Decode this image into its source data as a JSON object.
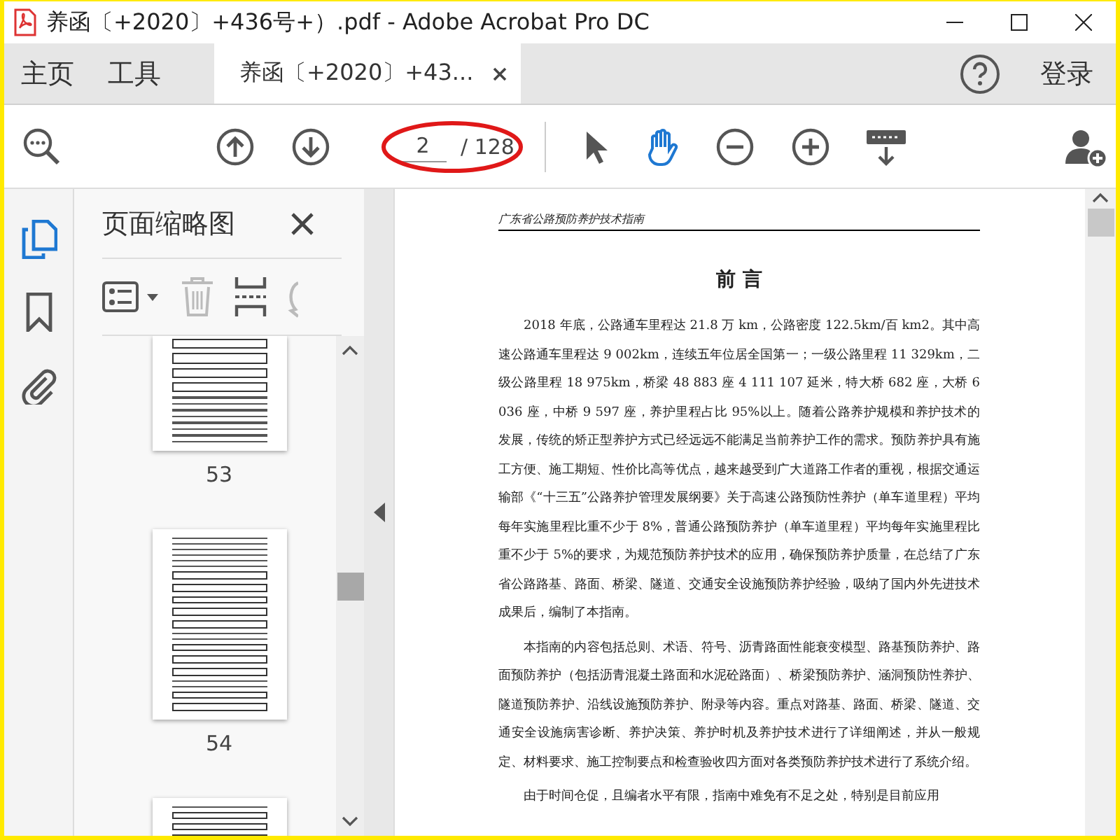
{
  "window": {
    "title": "养函〔+2020〕+436号+）.pdf - Adobe Acrobat Pro DC"
  },
  "tabs": [
    {
      "label": "主页",
      "kind": "nav",
      "selected": false
    },
    {
      "label": "工具",
      "kind": "nav",
      "selected": false
    },
    {
      "label": "养函〔+2020〕+43...",
      "kind": "document",
      "selected": true
    }
  ],
  "sign_in": "登录",
  "toolbar": {
    "page_current": "2",
    "page_total": "/ 128",
    "page_circled": true,
    "tools": [
      {
        "kind": "select",
        "selected": false
      },
      {
        "kind": "hand",
        "selected": true
      }
    ]
  },
  "sidebar": {
    "rail": [
      {
        "kind": "pages",
        "selected": true
      },
      {
        "kind": "bookmarks",
        "selected": false
      },
      {
        "kind": "attachments",
        "selected": false
      }
    ],
    "panel_title": "页面缩略图",
    "thumbnails": [
      {
        "label": "53",
        "kind": "partial",
        "selected": false
      },
      {
        "label": "54",
        "kind": "full",
        "selected": false
      },
      {
        "kind": "cut",
        "selected": false
      }
    ]
  },
  "document": {
    "running_header": "广东省公路预防养护技术指南",
    "heading": "前 言",
    "paragraphs": [
      "2018 年底，公路通车里程达 21.8 万 km，公路密度 122.5km/百 km2。其中高速公路通车里程达 9 002km，连续五年位居全国第一；一级公路里程 11 329km，二级公路里程 18 975km，桥梁 48 883 座 4 111 107 延米，特大桥 682 座，大桥 6 036 座，中桥 9 597 座，养护里程占比 95%以上。随着公路养护规模和养护技术的发展，传统的矫正型养护方式已经远远不能满足当前养护工作的需求。预防养护具有施工方便、施工期短、性价比高等优点，越来越受到广大道路工作者的重视，根据交通运输部《“十三五”公路养护管理发展纲要》关于高速公路预防性养护（单车道里程）平均每年实施里程比重不少于 8%，普通公路预防养护（单车道里程）平均每年实施里程比重不少于 5%的要求，为规范预防养护技术的应用，确保预防养护质量，在总结了广东省公路路基、路面、桥梁、隧道、交通安全设施预防养护经验，吸纳了国内外先进技术成果后，编制了本指南。",
      "本指南的内容包括总则、术语、符号、沥青路面性能衰变模型、路基预防养护、路面预防养护（包括沥青混凝土路面和水泥砼路面）、桥梁预防养护、涵洞预防性养护、隧道预防养护、沿线设施预防养护、附录等内容。重点对路基、路面、桥梁、隧道、交通安全设施病害诊断、养护决策、养护时机及养护技术进行了详细阐述，并从一般规定、材料要求、施工控制要点和检查验收四方面对各类预防养护技术进行了系统介绍。",
      "由于时间仓促，且编者水平有限，指南中难免有不足之处，特别是目前应用"
    ]
  }
}
